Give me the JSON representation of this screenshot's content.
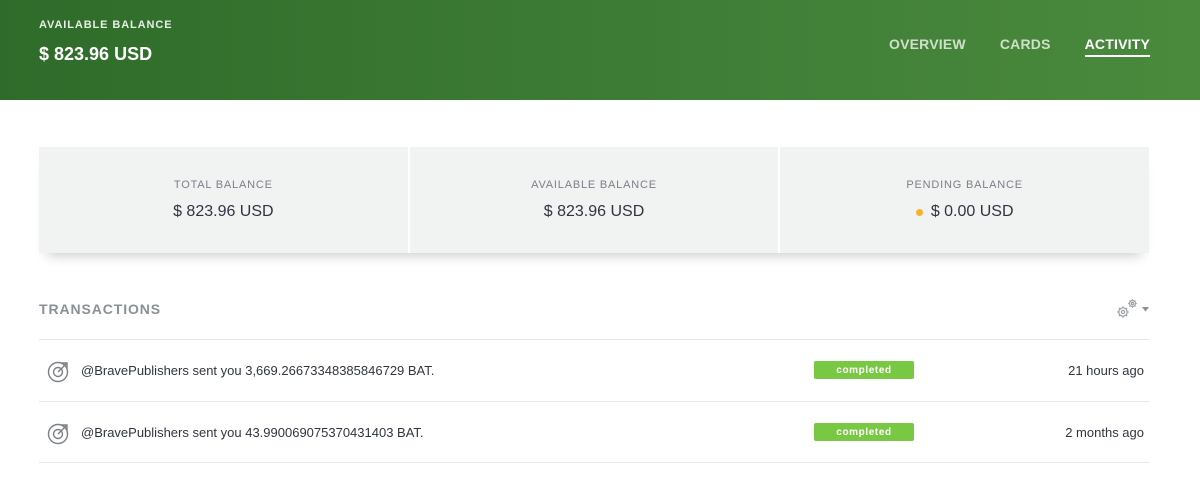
{
  "header": {
    "label": "AVAILABLE BALANCE",
    "balance": "$ 823.96 USD",
    "nav": [
      {
        "label": "OVERVIEW",
        "active": false
      },
      {
        "label": "CARDS",
        "active": false
      },
      {
        "label": "ACTIVITY",
        "active": true
      }
    ]
  },
  "stats": [
    {
      "label": "TOTAL BALANCE",
      "value": "$ 823.96 USD"
    },
    {
      "label": "AVAILABLE BALANCE",
      "value": "$ 823.96 USD"
    },
    {
      "label": "PENDING BALANCE",
      "value": "$ 0.00 USD"
    }
  ],
  "transactions": {
    "title": "TRANSACTIONS",
    "rows": [
      {
        "description": "@BravePublishers sent you 3,669.26673348385846729 BAT.",
        "status": "completed",
        "time": "21 hours ago"
      },
      {
        "description": "@BravePublishers sent you 43.990069075370431403 BAT.",
        "status": "completed",
        "time": "2 months ago"
      }
    ]
  },
  "colors": {
    "header_start": "#2f6b2a",
    "header_end": "#4a8a3d",
    "status_completed": "#79c843",
    "pending_dot": "#f5b22b"
  },
  "icons": {
    "settings": "gears-icon",
    "dropdown": "caret-down-icon",
    "transaction": "receive-icon"
  }
}
